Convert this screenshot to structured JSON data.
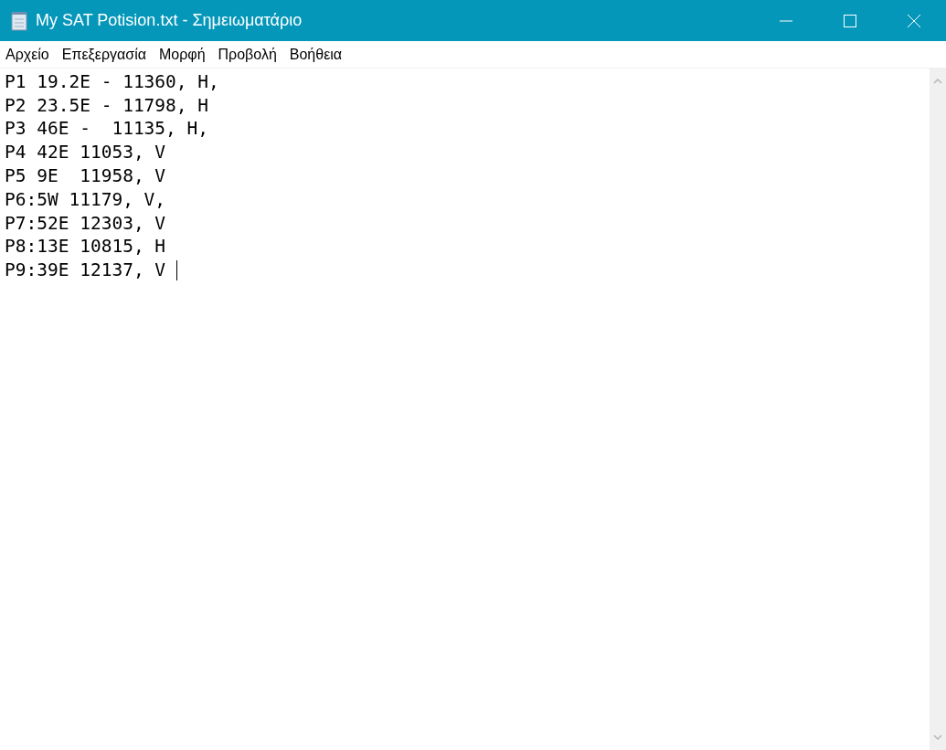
{
  "window": {
    "title": "My SAT Potision.txt - Σημειωματάριο"
  },
  "menu": [
    "Αρχείο",
    "Επεξεργασία",
    "Μορφή",
    "Προβολή",
    "Βοήθεια"
  ],
  "editor": {
    "lines": [
      "P1 19.2E - 11360, H,",
      "P2 23.5E - 11798, H",
      "P3 46E -  11135, H,",
      "P4 42E 11053, V",
      "P5 9E  11958, V",
      "P6:5W 11179, V,",
      "P7:52E 12303, V",
      "P8:13E 10815, H",
      "P9:39E 12137, V "
    ]
  }
}
